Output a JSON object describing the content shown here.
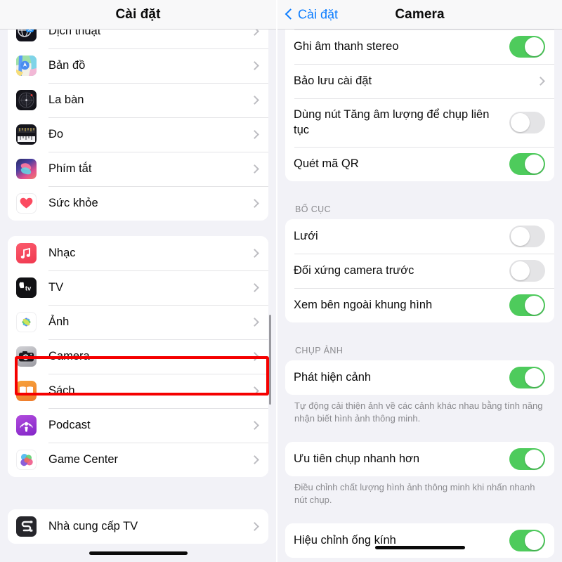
{
  "left_panel": {
    "nav": {
      "title": "Cài đặt"
    },
    "groups": [
      {
        "clipped_top": true,
        "rows": [
          {
            "label": "Dịch thuật",
            "icon": "translate-app-icon",
            "accessory": "chevron"
          },
          {
            "label": "Bản đồ",
            "icon": "maps-app-icon",
            "accessory": "chevron"
          },
          {
            "label": "La bàn",
            "icon": "compass-app-icon",
            "accessory": "chevron"
          },
          {
            "label": "Đo",
            "icon": "measure-app-icon",
            "accessory": "chevron"
          },
          {
            "label": "Phím tắt",
            "icon": "shortcuts-app-icon",
            "accessory": "chevron"
          },
          {
            "label": "Sức khỏe",
            "icon": "health-app-icon",
            "accessory": "chevron"
          }
        ]
      },
      {
        "clipped_top": false,
        "rows": [
          {
            "label": "Nhạc",
            "icon": "music-app-icon",
            "accessory": "chevron"
          },
          {
            "label": "TV",
            "icon": "tv-app-icon",
            "accessory": "chevron"
          },
          {
            "label": "Ảnh",
            "icon": "photos-app-icon",
            "accessory": "chevron"
          },
          {
            "label": "Camera",
            "icon": "camera-app-icon",
            "accessory": "chevron",
            "highlighted": true
          },
          {
            "label": "Sách",
            "icon": "books-app-icon",
            "accessory": "chevron"
          },
          {
            "label": "Podcast",
            "icon": "podcast-app-icon",
            "accessory": "chevron"
          },
          {
            "label": "Game Center",
            "icon": "gamecenter-app-icon",
            "accessory": "chevron"
          }
        ]
      },
      {
        "clipped_top": false,
        "rows": [
          {
            "label": "Nhà cung cấp TV",
            "icon": "tvprovider-app-icon",
            "accessory": "chevron"
          }
        ]
      }
    ]
  },
  "right_panel": {
    "nav": {
      "back_label": "Cài đặt",
      "title": "Camera"
    },
    "groups": [
      {
        "clipped_top": true,
        "header": "",
        "rows": [
          {
            "label": "Ghi âm thanh stereo",
            "accessory": "toggle",
            "toggle_on": true
          },
          {
            "label": "Bảo lưu cài đặt",
            "accessory": "chevron"
          },
          {
            "label": "Dùng nút Tăng âm lượng để chụp liên tục",
            "accessory": "toggle",
            "toggle_on": false,
            "two_line": true
          },
          {
            "label": "Quét mã QR",
            "accessory": "toggle",
            "toggle_on": true
          }
        ]
      },
      {
        "header": "BỐ CỤC",
        "rows": [
          {
            "label": "Lưới",
            "accessory": "toggle",
            "toggle_on": false
          },
          {
            "label": "Đối xứng camera trước",
            "accessory": "toggle",
            "toggle_on": false,
            "highlighted": true
          },
          {
            "label": "Xem bên ngoài khung hình",
            "accessory": "toggle",
            "toggle_on": true
          }
        ]
      },
      {
        "header": "CHỤP ẢNH",
        "rows": [
          {
            "label": "Phát hiện cảnh",
            "accessory": "toggle",
            "toggle_on": true
          }
        ],
        "footnote": "Tự động cải thiện ảnh về các cảnh khác nhau bằng tính năng nhận biết hình ảnh thông minh."
      },
      {
        "rows": [
          {
            "label": "Ưu tiên chụp nhanh hơn",
            "accessory": "toggle",
            "toggle_on": true
          }
        ],
        "footnote": "Điều chỉnh chất lượng hình ảnh thông minh khi nhấn nhanh nút chụp."
      },
      {
        "rows": [
          {
            "label": "Hiệu chỉnh ống kính",
            "accessory": "toggle",
            "toggle_on": true
          }
        ]
      }
    ]
  },
  "colors": {
    "accent_blue": "#0a7cff",
    "toggle_on": "#4ecb5c",
    "toggle_off": "#e4e4e6",
    "highlight_red": "#f50000",
    "page_background": "#f2f2f7",
    "card_background": "#ffffff",
    "secondary_text": "#8a8a8e"
  }
}
